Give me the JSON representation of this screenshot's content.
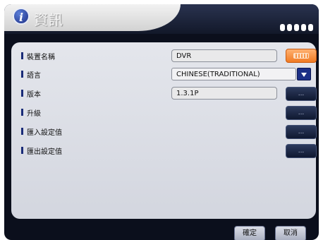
{
  "header": {
    "title": "資訊",
    "icon": "info-icon",
    "indicator_count": 5
  },
  "rows": [
    {
      "label": "裝置名稱",
      "value": "DVR",
      "control": "keyboard-button"
    },
    {
      "label": "語言",
      "value": "CHINESE(TRADITIONAL)",
      "control": "dropdown"
    },
    {
      "label": "版本",
      "value": "1.3.1P",
      "button": "..."
    },
    {
      "label": "升級",
      "button": "..."
    },
    {
      "label": "匯入設定值",
      "button": "..."
    },
    {
      "label": "匯出設定值",
      "button": "..."
    }
  ],
  "footer": {
    "ok_label": "確定",
    "cancel_label": "取消"
  },
  "colors": {
    "accent_blue": "#1b2f86",
    "keyboard_orange": "#f07a24",
    "panel_bg": "#dfe1e8",
    "frame_bg": "#0b0f1c"
  }
}
